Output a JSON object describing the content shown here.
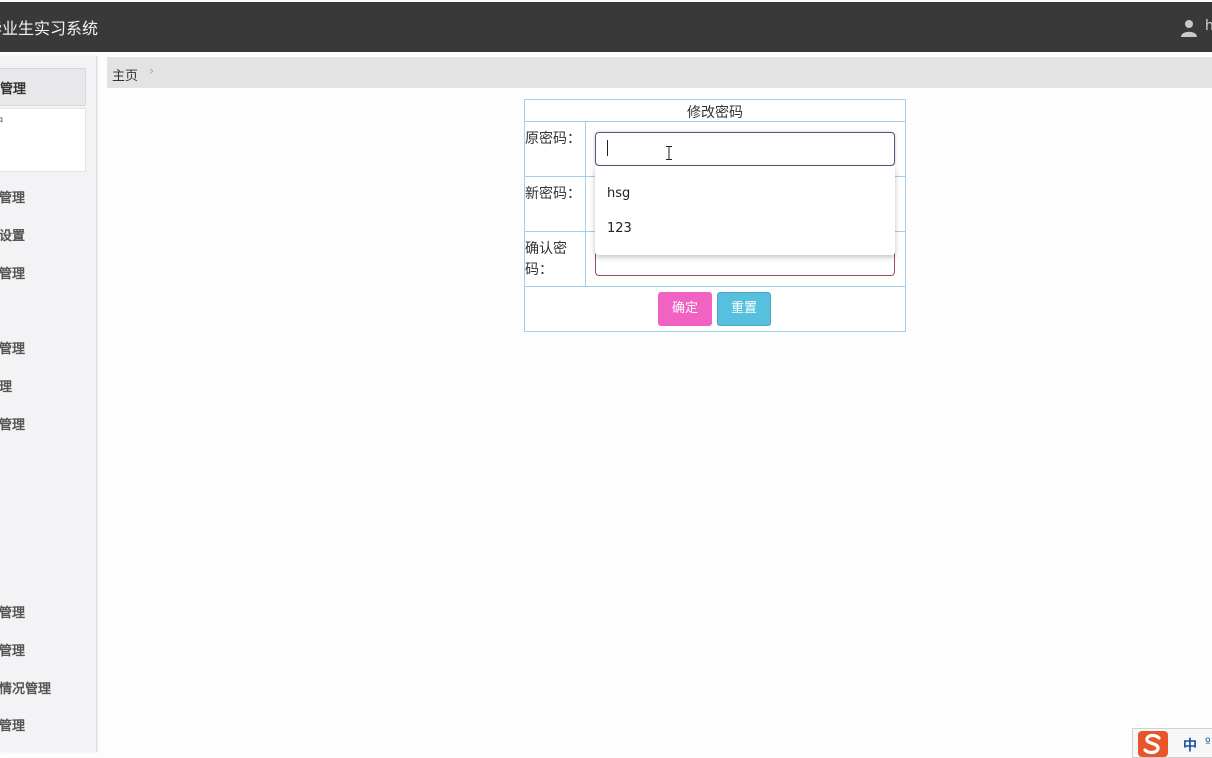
{
  "header": {
    "app_title": "毕业生实习系统",
    "user_name": "h"
  },
  "sidebar": {
    "active_item": "管理",
    "sub_item": "户",
    "items": [
      "管理",
      "设置",
      "管理",
      "管理",
      "理",
      "管理",
      "管理",
      "管理",
      "情况管理",
      "管理"
    ]
  },
  "breadcrumb": {
    "home": "主页",
    "separator": "›"
  },
  "form": {
    "title": "修改密码",
    "old_password_label": "原密码：",
    "new_password_label": "新密码：",
    "confirm_password_label": "确认密码：",
    "old_password_value": "",
    "new_password_value": "",
    "confirm_password_value": "",
    "submit_label": "确定",
    "reset_label": "重置"
  },
  "autocomplete": {
    "options": [
      "hsg",
      "123"
    ]
  },
  "ime": {
    "mode": "中",
    "punct": "º"
  },
  "colors": {
    "topbar": "#393939",
    "submit": "#f063c2",
    "reset": "#57c0de",
    "table_border": "#9dd2ea"
  }
}
